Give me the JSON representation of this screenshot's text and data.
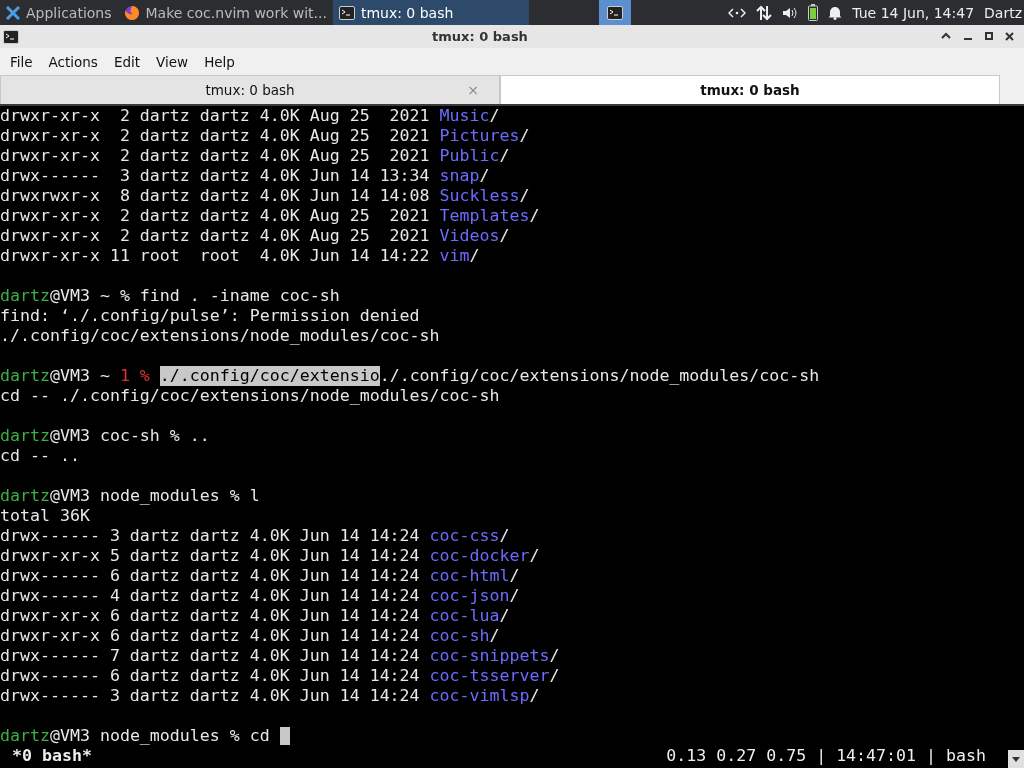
{
  "panel": {
    "apps_label": "Applications",
    "tasks": [
      {
        "label": "Make coc.nvim work wit...",
        "selected": false
      },
      {
        "label": "tmux: 0 bash",
        "selected": true
      }
    ],
    "clock": "Tue 14 Jun, 14:47",
    "user": "Dartz"
  },
  "window": {
    "title": "tmux: 0 bash"
  },
  "menu": [
    "File",
    "Actions",
    "Edit",
    "View",
    "Help"
  ],
  "tabs": [
    {
      "label": "tmux: 0 bash",
      "selected": false,
      "close": "×"
    },
    {
      "label": "tmux: 0 bash",
      "selected": true
    }
  ],
  "terminal": {
    "lines": [
      {
        "kind": "text",
        "segments": [
          {
            "kind": "plain",
            "text": "drwxr-xr-x  2 dartz dartz 4.0K Aug 25  2021 "
          },
          {
            "kind": "dir",
            "text": "Music"
          },
          {
            "kind": "plain",
            "text": "/"
          }
        ]
      },
      {
        "kind": "text",
        "segments": [
          {
            "kind": "plain",
            "text": "drwxr-xr-x  2 dartz dartz 4.0K Aug 25  2021 "
          },
          {
            "kind": "dir",
            "text": "Pictures"
          },
          {
            "kind": "plain",
            "text": "/"
          }
        ]
      },
      {
        "kind": "text",
        "segments": [
          {
            "kind": "plain",
            "text": "drwxr-xr-x  2 dartz dartz 4.0K Aug 25  2021 "
          },
          {
            "kind": "dir",
            "text": "Public"
          },
          {
            "kind": "plain",
            "text": "/"
          }
        ]
      },
      {
        "kind": "text",
        "segments": [
          {
            "kind": "plain",
            "text": "drwx------  3 dartz dartz 4.0K Jun 14 13:34 "
          },
          {
            "kind": "dir",
            "text": "snap"
          },
          {
            "kind": "plain",
            "text": "/"
          }
        ]
      },
      {
        "kind": "text",
        "segments": [
          {
            "kind": "plain",
            "text": "drwxrwxr-x  8 dartz dartz 4.0K Jun 14 14:08 "
          },
          {
            "kind": "dir",
            "text": "Suckless"
          },
          {
            "kind": "plain",
            "text": "/"
          }
        ]
      },
      {
        "kind": "text",
        "segments": [
          {
            "kind": "plain",
            "text": "drwxr-xr-x  2 dartz dartz 4.0K Aug 25  2021 "
          },
          {
            "kind": "dir",
            "text": "Templates"
          },
          {
            "kind": "plain",
            "text": "/"
          }
        ]
      },
      {
        "kind": "text",
        "segments": [
          {
            "kind": "plain",
            "text": "drwxr-xr-x  2 dartz dartz 4.0K Aug 25  2021 "
          },
          {
            "kind": "dir",
            "text": "Videos"
          },
          {
            "kind": "plain",
            "text": "/"
          }
        ]
      },
      {
        "kind": "text",
        "segments": [
          {
            "kind": "plain",
            "text": "drwxr-xr-x 11 root  root  4.0K Jun 14 14:22 "
          },
          {
            "kind": "dir",
            "text": "vim"
          },
          {
            "kind": "plain",
            "text": "/"
          }
        ]
      },
      {
        "kind": "blank"
      },
      {
        "kind": "text",
        "segments": [
          {
            "kind": "user",
            "text": "dartz"
          },
          {
            "kind": "plain",
            "text": "@VM3 ~ % find . -iname coc-sh"
          }
        ]
      },
      {
        "kind": "text",
        "segments": [
          {
            "kind": "plain",
            "text": "find: ‘./.config/pulse’: Permission denied"
          }
        ]
      },
      {
        "kind": "text",
        "segments": [
          {
            "kind": "plain",
            "text": "./.config/coc/extensions/node_modules/coc-sh"
          }
        ]
      },
      {
        "kind": "blank"
      },
      {
        "kind": "text",
        "segments": [
          {
            "kind": "user",
            "text": "dartz"
          },
          {
            "kind": "plain",
            "text": "@VM3 ~ "
          },
          {
            "kind": "error",
            "text": "1 % "
          },
          {
            "kind": "selection",
            "text": "./.config/coc/extensio"
          },
          {
            "kind": "plain",
            "text": "./.config/coc/extensions/node_modules/coc-sh"
          }
        ]
      },
      {
        "kind": "text",
        "segments": [
          {
            "kind": "plain",
            "text": "cd -- ./.config/coc/extensions/node_modules/coc-sh"
          }
        ]
      },
      {
        "kind": "blank"
      },
      {
        "kind": "text",
        "segments": [
          {
            "kind": "user",
            "text": "dartz"
          },
          {
            "kind": "plain",
            "text": "@VM3 coc-sh % .."
          }
        ]
      },
      {
        "kind": "text",
        "segments": [
          {
            "kind": "plain",
            "text": "cd -- .."
          }
        ]
      },
      {
        "kind": "blank"
      },
      {
        "kind": "text",
        "segments": [
          {
            "kind": "user",
            "text": "dartz"
          },
          {
            "kind": "plain",
            "text": "@VM3 node_modules % l"
          }
        ]
      },
      {
        "kind": "text",
        "segments": [
          {
            "kind": "plain",
            "text": "total 36K"
          }
        ]
      },
      {
        "kind": "text",
        "segments": [
          {
            "kind": "plain",
            "text": "drwx------ 3 dartz dartz 4.0K Jun 14 14:24 "
          },
          {
            "kind": "dir",
            "text": "coc-css"
          },
          {
            "kind": "plain",
            "text": "/"
          }
        ]
      },
      {
        "kind": "text",
        "segments": [
          {
            "kind": "plain",
            "text": "drwxr-xr-x 5 dartz dartz 4.0K Jun 14 14:24 "
          },
          {
            "kind": "dir",
            "text": "coc-docker"
          },
          {
            "kind": "plain",
            "text": "/"
          }
        ]
      },
      {
        "kind": "text",
        "segments": [
          {
            "kind": "plain",
            "text": "drwx------ 6 dartz dartz 4.0K Jun 14 14:24 "
          },
          {
            "kind": "dir",
            "text": "coc-html"
          },
          {
            "kind": "plain",
            "text": "/"
          }
        ]
      },
      {
        "kind": "text",
        "segments": [
          {
            "kind": "plain",
            "text": "drwx------ 4 dartz dartz 4.0K Jun 14 14:24 "
          },
          {
            "kind": "dir",
            "text": "coc-json"
          },
          {
            "kind": "plain",
            "text": "/"
          }
        ]
      },
      {
        "kind": "text",
        "segments": [
          {
            "kind": "plain",
            "text": "drwxr-xr-x 6 dartz dartz 4.0K Jun 14 14:24 "
          },
          {
            "kind": "dir",
            "text": "coc-lua"
          },
          {
            "kind": "plain",
            "text": "/"
          }
        ]
      },
      {
        "kind": "text",
        "segments": [
          {
            "kind": "plain",
            "text": "drwxr-xr-x 6 dartz dartz 4.0K Jun 14 14:24 "
          },
          {
            "kind": "dir",
            "text": "coc-sh"
          },
          {
            "kind": "plain",
            "text": "/"
          }
        ]
      },
      {
        "kind": "text",
        "segments": [
          {
            "kind": "plain",
            "text": "drwx------ 7 dartz dartz 4.0K Jun 14 14:24 "
          },
          {
            "kind": "dir",
            "text": "coc-snippets"
          },
          {
            "kind": "plain",
            "text": "/"
          }
        ]
      },
      {
        "kind": "text",
        "segments": [
          {
            "kind": "plain",
            "text": "drwx------ 6 dartz dartz 4.0K Jun 14 14:24 "
          },
          {
            "kind": "dir",
            "text": "coc-tsserver"
          },
          {
            "kind": "plain",
            "text": "/"
          }
        ]
      },
      {
        "kind": "text",
        "segments": [
          {
            "kind": "plain",
            "text": "drwx------ 3 dartz dartz 4.0K Jun 14 14:24 "
          },
          {
            "kind": "dir",
            "text": "coc-vimlsp"
          },
          {
            "kind": "plain",
            "text": "/"
          }
        ]
      },
      {
        "kind": "blank"
      },
      {
        "kind": "text",
        "cursor": true,
        "segments": [
          {
            "kind": "user",
            "text": "dartz"
          },
          {
            "kind": "plain",
            "text": "@VM3 node_modules % cd "
          }
        ]
      }
    ]
  },
  "status_bar": {
    "left": "*0 bash*",
    "right": "0.13 0.27 0.75 | 14:47:01 | bash"
  }
}
